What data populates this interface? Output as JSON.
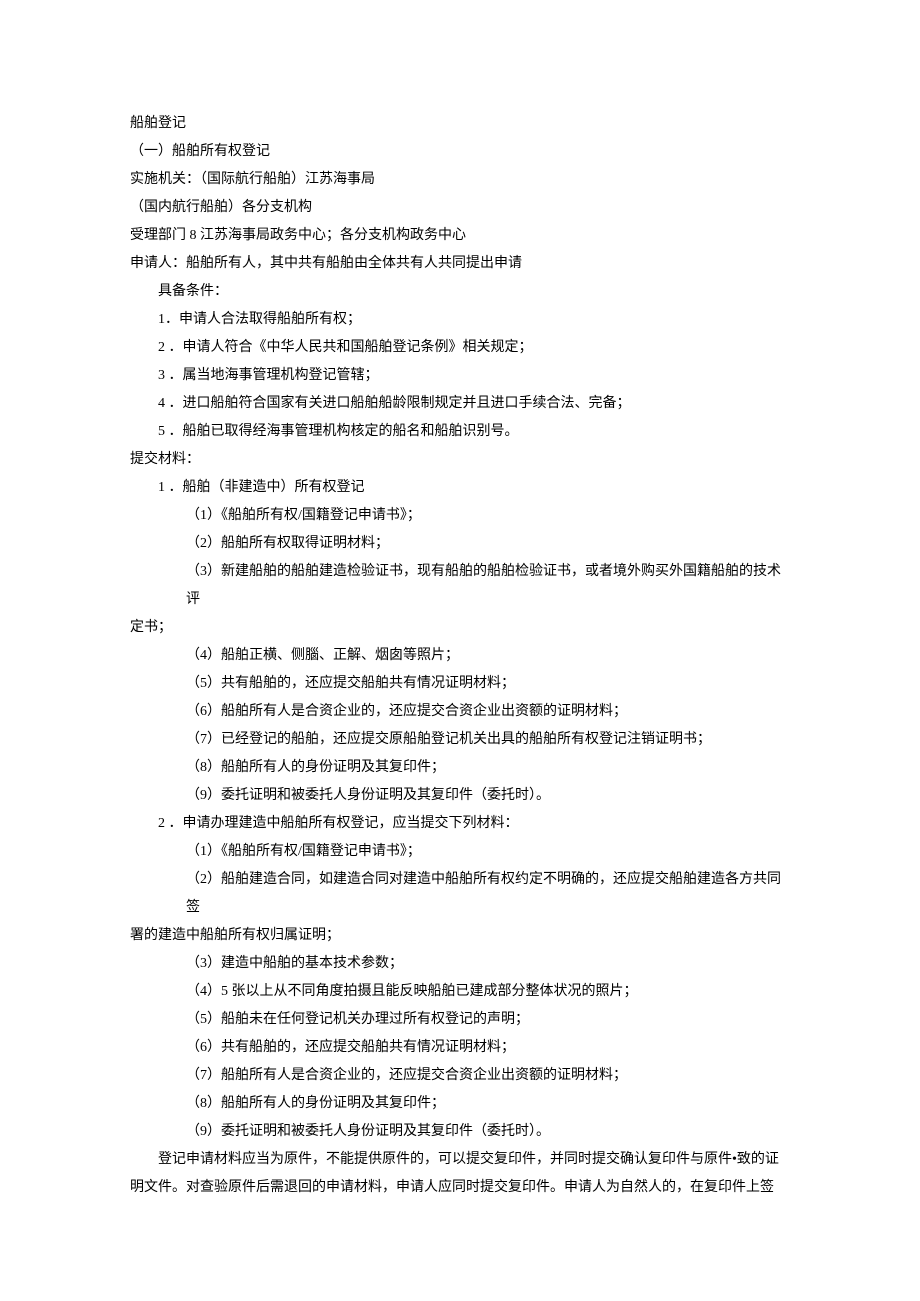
{
  "title": "船舶登记",
  "sectionHeader": "（一）船舶所有权登记",
  "agencyLine1": "实施机关：（国际航行船舶）江苏海事局",
  "agencyLine2": "（国内航行船舶）各分支机构",
  "acceptDept": "受理部门 8 江苏海事局政务中心；各分支机构政务中心",
  "applicant": "申请人：船舶所有人，其中共有船舶由全体共有人共同提出申请",
  "conditionsLabel": "具备条件：",
  "conditions": [
    "1．申请人合法取得船舶所有权；",
    "2 ．申请人符合《中华人民共和国船舶登记条例》相关规定；",
    "3 ．属当地海事管理机构登记管辖；",
    "4 ．进口船舶符合国家有关进口船舶船龄限制规定并且进口手续合法、完备；",
    "5 ．船舶已取得经海事管理机构核定的船名和船舶识别号。"
  ],
  "materialsLabel": "提交材料：",
  "sectionA": {
    "header": "1 ．船舶（非建造中）所有权登记",
    "items": [
      "（1）《船舶所有权/国籍登记申请书》；",
      "（2）船舶所有权取得证明材料；"
    ],
    "item3a": "（3）新建船舶的船舶建造检验证书，现有船舶的船舶检验证书，或者境外购买外国籍船舶的技术评",
    "item3b": "定书；",
    "itemsRest": [
      "（4）船舶正横、侧腦、正解、烟囱等照片；",
      "（5）共有船舶的，还应提交船舶共有情况证明材料；",
      "（6）船舶所有人是合资企业的，还应提交合资企业出资额的证明材料；",
      "（7）已经登记的船舶，还应提交原船舶登记机关出具的船舶所有权登记注销证明书；",
      "（8）船舶所有人的身份证明及其复印件；",
      "（9）委托证明和被委托人身份证明及其复印件（委托时）。"
    ]
  },
  "sectionB": {
    "header": "2 ．申请办理建造中船舶所有权登记，应当提交下列材料：",
    "item1": "（1）《船舶所有权/国籍登记申请书》；",
    "item2a": "（2）船舶建造合同，如建造合同对建造中船舶所有权约定不明确的，还应提交船舶建造各方共同签",
    "item2b": "署的建造中船舶所有权归属证明；",
    "itemsRest": [
      "（3）建造中船舶的基本技术参数；",
      "（4）5 张以上从不同角度拍摄且能反映船舶已建成部分整体状况的照片；",
      "（5）船舶未在任何登记机关办理过所有权登记的声明；",
      "（6）共有船舶的，还应提交船舶共有情况证明材料；",
      "（7）船舶所有人是合资企业的，还应提交合资企业出资额的证明材料；",
      "（8）船舶所有人的身份证明及其复印件；",
      "（9）委托证明和被委托人身份证明及其复印件（委托时）。"
    ]
  },
  "footer1": "登记申请材料应当为原件，不能提供原件的，可以提交复印件，并同时提交确认复印件与原件•致的证",
  "footer2": "明文件。对查验原件后需退回的申请材料，申请人应同时提交复印件。申请人为自然人的，在复印件上签"
}
